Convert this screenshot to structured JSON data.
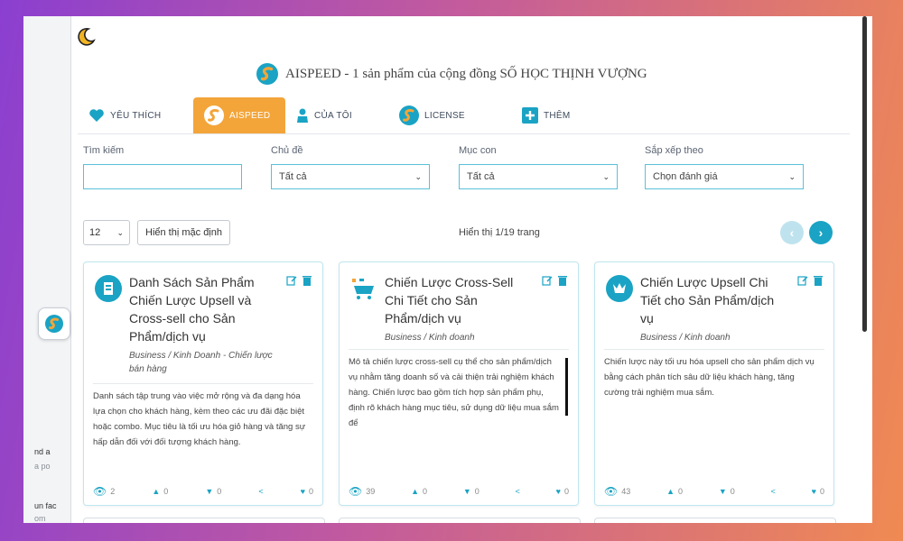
{
  "header": {
    "title": "AISPEED - 1 sản phẩm của cộng đồng SỐ HỌC THỊNH VƯỢNG"
  },
  "left_strip": {
    "snippets": [
      "nd a",
      "a po",
      "un fac",
      "om"
    ]
  },
  "tabs": [
    {
      "label": "YÊU THÍCH",
      "icon": "heart-icon",
      "active": false
    },
    {
      "label": "AISPEED",
      "icon": "aispeed-logo-icon",
      "active": true
    },
    {
      "label": "CỦA TÔI",
      "icon": "user-icon",
      "active": false
    },
    {
      "label": "LICENSE",
      "icon": "aispeed-logo-icon",
      "active": false
    },
    {
      "label": "THÊM",
      "icon": "plus-icon",
      "active": false
    }
  ],
  "filters": {
    "search": {
      "label": "Tìm kiếm",
      "value": ""
    },
    "topic": {
      "label": "Chủ đề",
      "value": "Tất cả"
    },
    "subtopic": {
      "label": "Mục con",
      "value": "Tất cả"
    },
    "sort": {
      "label": "Sắp xếp theo",
      "value": "Chọn đánh giá"
    }
  },
  "controls": {
    "per_page": "12",
    "default_view_label": "Hiển thị mặc định",
    "page_info": "Hiển thị 1/19 trang"
  },
  "colors": {
    "accent_orange": "#f3a53a",
    "accent_teal": "#1aa3c4",
    "border_teal": "#5bc0d8"
  },
  "cards": [
    {
      "title": "Danh Sách Sản Phẩm Chiến Lược Upsell và Cross-sell cho Sản Phẩm/dịch vụ",
      "category": "Business / Kinh Doanh - Chiến lược bán hàng",
      "description": "Danh sách tập trung vào việc mở rộng và đa dạng hóa lựa chọn cho khách hàng, kèm theo các ưu đãi đặc biệt hoặc combo. Mục tiêu là tối ưu hóa giỏ hàng và tăng sự hấp dẫn đối với đối tượng khách hàng.",
      "views": "2",
      "likes": "0",
      "dislikes": "0",
      "favorites": "0"
    },
    {
      "title": "Chiến Lược Cross-Sell Chi Tiết cho Sản Phẩm/dịch vụ",
      "category": "Business / Kinh doanh",
      "description": "Mô tả chiến lược cross-sell cụ thể cho sản phẩm/dịch vụ nhằm tăng doanh số và cải thiện trải nghiệm khách hàng. Chiến lược bao gồm tích hợp sản phẩm phụ, định rõ khách hàng mục tiêu, sử dụng dữ liệu mua sắm để",
      "views": "39",
      "likes": "0",
      "dislikes": "0",
      "favorites": "0"
    },
    {
      "title": "Chiến Lược Upsell Chi Tiết cho Sản Phẩm/dịch vụ",
      "category": "Business / Kinh doanh",
      "description": "Chiến lược này tối ưu hóa upsell cho sản phẩm dịch vụ bằng cách phân tích sâu dữ liệu khách hàng, tăng cường trải nghiệm mua sắm.",
      "views": "43",
      "likes": "0",
      "dislikes": "0",
      "favorites": "0"
    }
  ]
}
